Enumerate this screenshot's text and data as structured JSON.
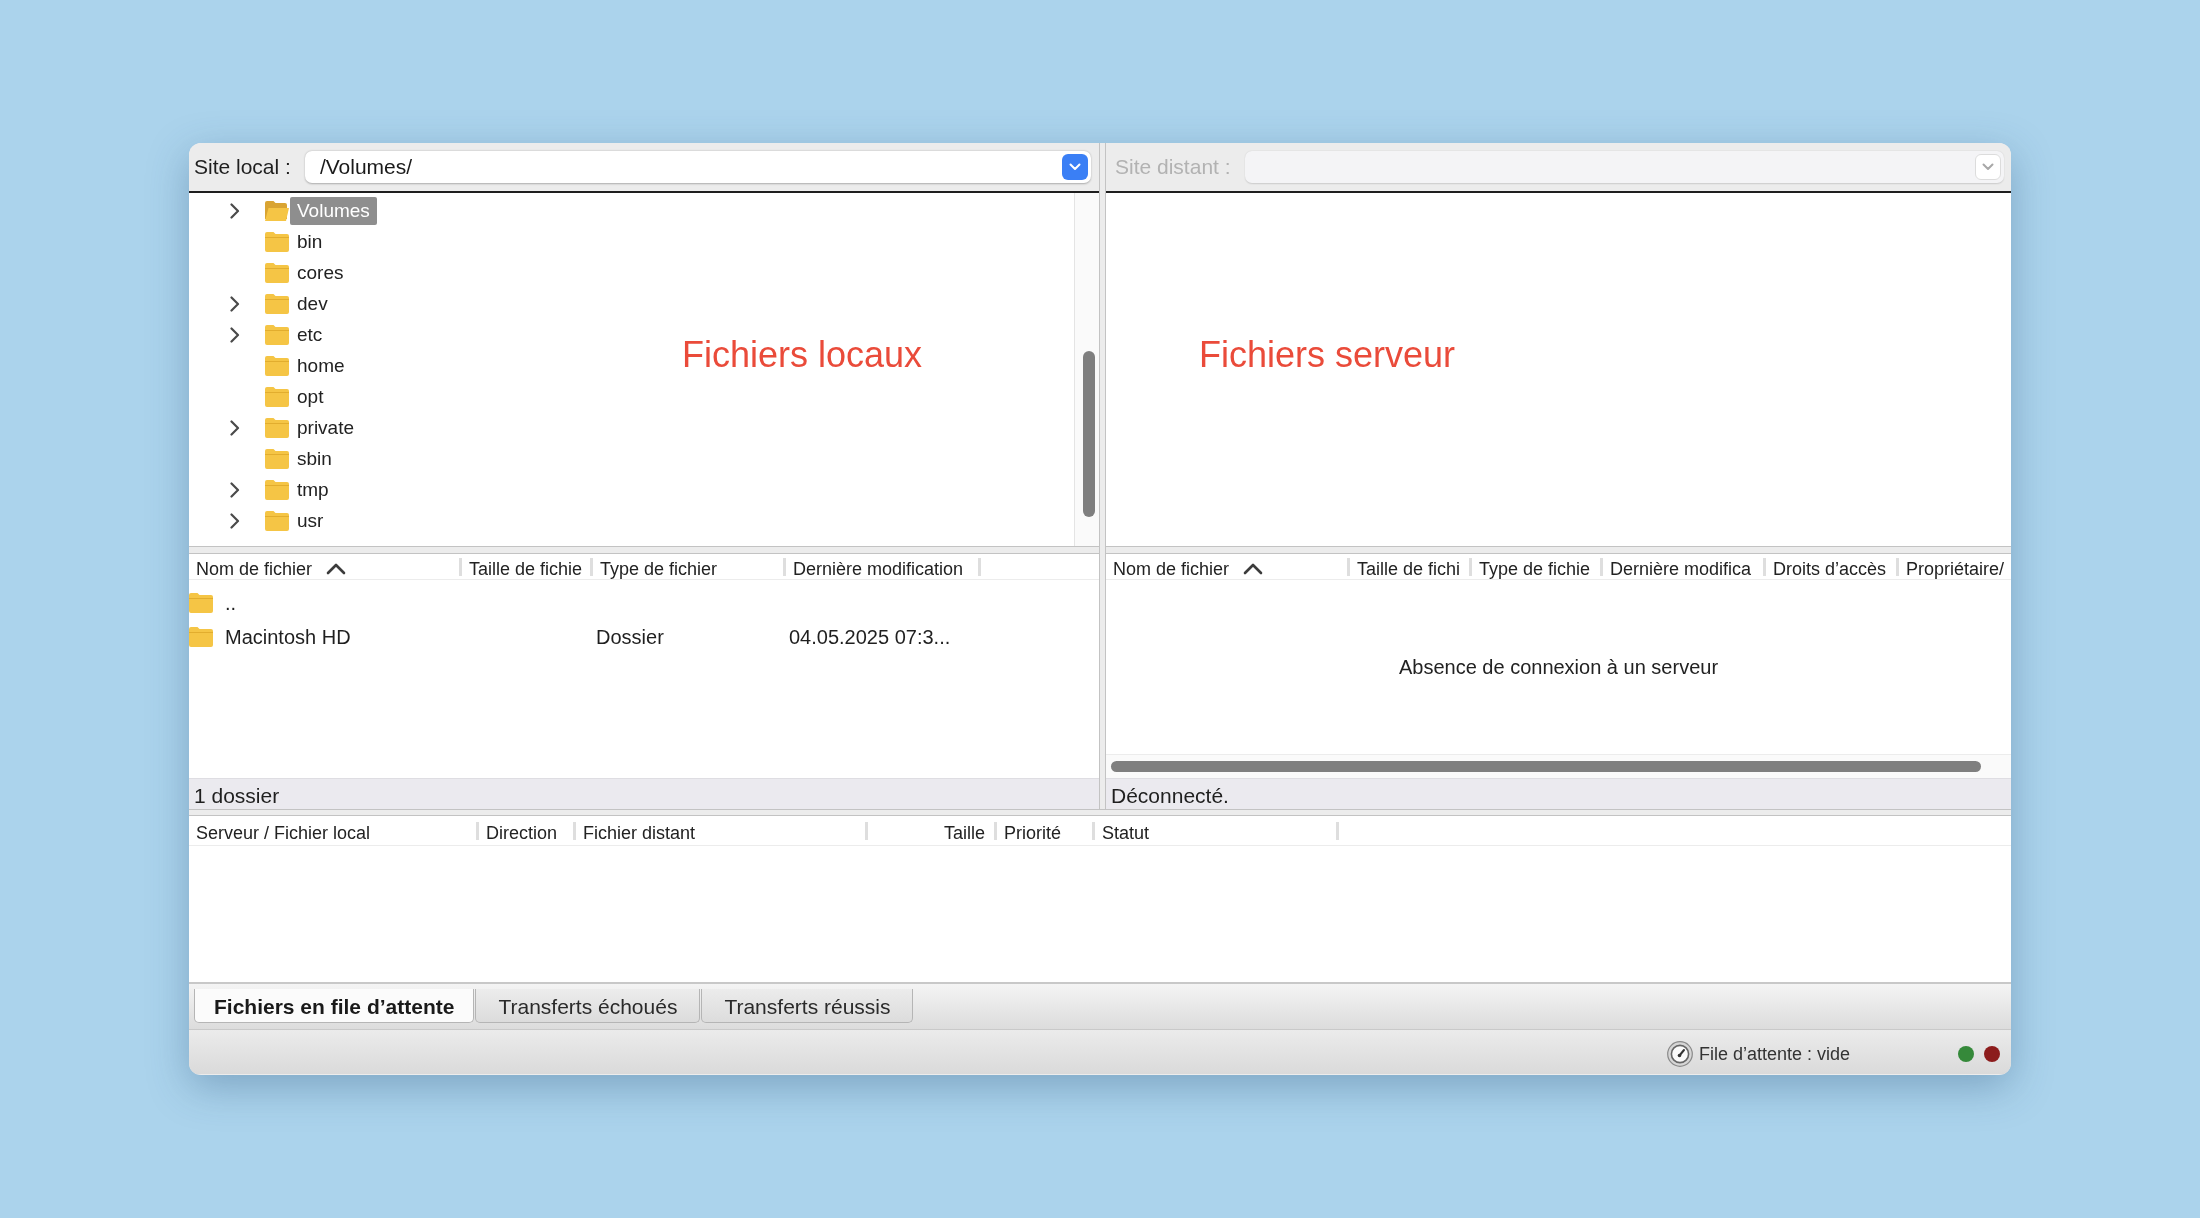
{
  "local": {
    "site": {
      "label": "Site local :",
      "value": "/Volumes/",
      "disabled": false
    },
    "annotation": "Fichiers locaux",
    "tree": [
      {
        "name": "Volumes",
        "expandable": true,
        "selected": true
      },
      {
        "name": "bin",
        "expandable": false,
        "selected": false
      },
      {
        "name": "cores",
        "expandable": false,
        "selected": false
      },
      {
        "name": "dev",
        "expandable": true,
        "selected": false
      },
      {
        "name": "etc",
        "expandable": true,
        "selected": false
      },
      {
        "name": "home",
        "expandable": false,
        "selected": false
      },
      {
        "name": "opt",
        "expandable": false,
        "selected": false
      },
      {
        "name": "private",
        "expandable": true,
        "selected": false
      },
      {
        "name": "sbin",
        "expandable": false,
        "selected": false
      },
      {
        "name": "tmp",
        "expandable": true,
        "selected": false
      },
      {
        "name": "usr",
        "expandable": true,
        "selected": false
      }
    ],
    "columns": [
      {
        "label": "Nom de fichier",
        "sorted": true
      },
      {
        "label": "Taille de fichie",
        "sorted": false
      },
      {
        "label": "Type de fichier",
        "sorted": false
      },
      {
        "label": "Dernière modification",
        "sorted": false
      }
    ],
    "rows": [
      {
        "name": ".."
      },
      {
        "name": "Macintosh HD",
        "type": "Dossier",
        "modified": "04.05.2025 07:3..."
      }
    ],
    "status": "1 dossier"
  },
  "remote": {
    "site": {
      "label": "Site distant :",
      "disabled": true
    },
    "annotation": "Fichiers serveur",
    "columns": [
      {
        "label": "Nom de fichier",
        "sorted": true
      },
      {
        "label": "Taille de fichi",
        "sorted": false
      },
      {
        "label": "Type de fichie",
        "sorted": false
      },
      {
        "label": "Dernière modifica",
        "sorted": false
      },
      {
        "label": "Droits d’accès",
        "sorted": false
      },
      {
        "label": "Propriétaire/",
        "sorted": false
      }
    ],
    "empty_message": "Absence de connexion à un serveur",
    "status": "Déconnecté."
  },
  "queue": {
    "columns": [
      {
        "label": "Serveur / Fichier local"
      },
      {
        "label": "Direction"
      },
      {
        "label": "Fichier distant"
      },
      {
        "label": "Taille"
      },
      {
        "label": "Priorité"
      },
      {
        "label": "Statut"
      }
    ]
  },
  "tabs": [
    {
      "label": "Fichiers en file d’attente",
      "selected": true
    },
    {
      "label": "Transferts échoués",
      "selected": false
    },
    {
      "label": "Transferts réussis",
      "selected": false
    }
  ],
  "status_bar": {
    "queue_text": "File d’attente : vide",
    "lights": [
      {
        "color": "#35893a"
      },
      {
        "color": "#8c1c1c"
      }
    ]
  }
}
